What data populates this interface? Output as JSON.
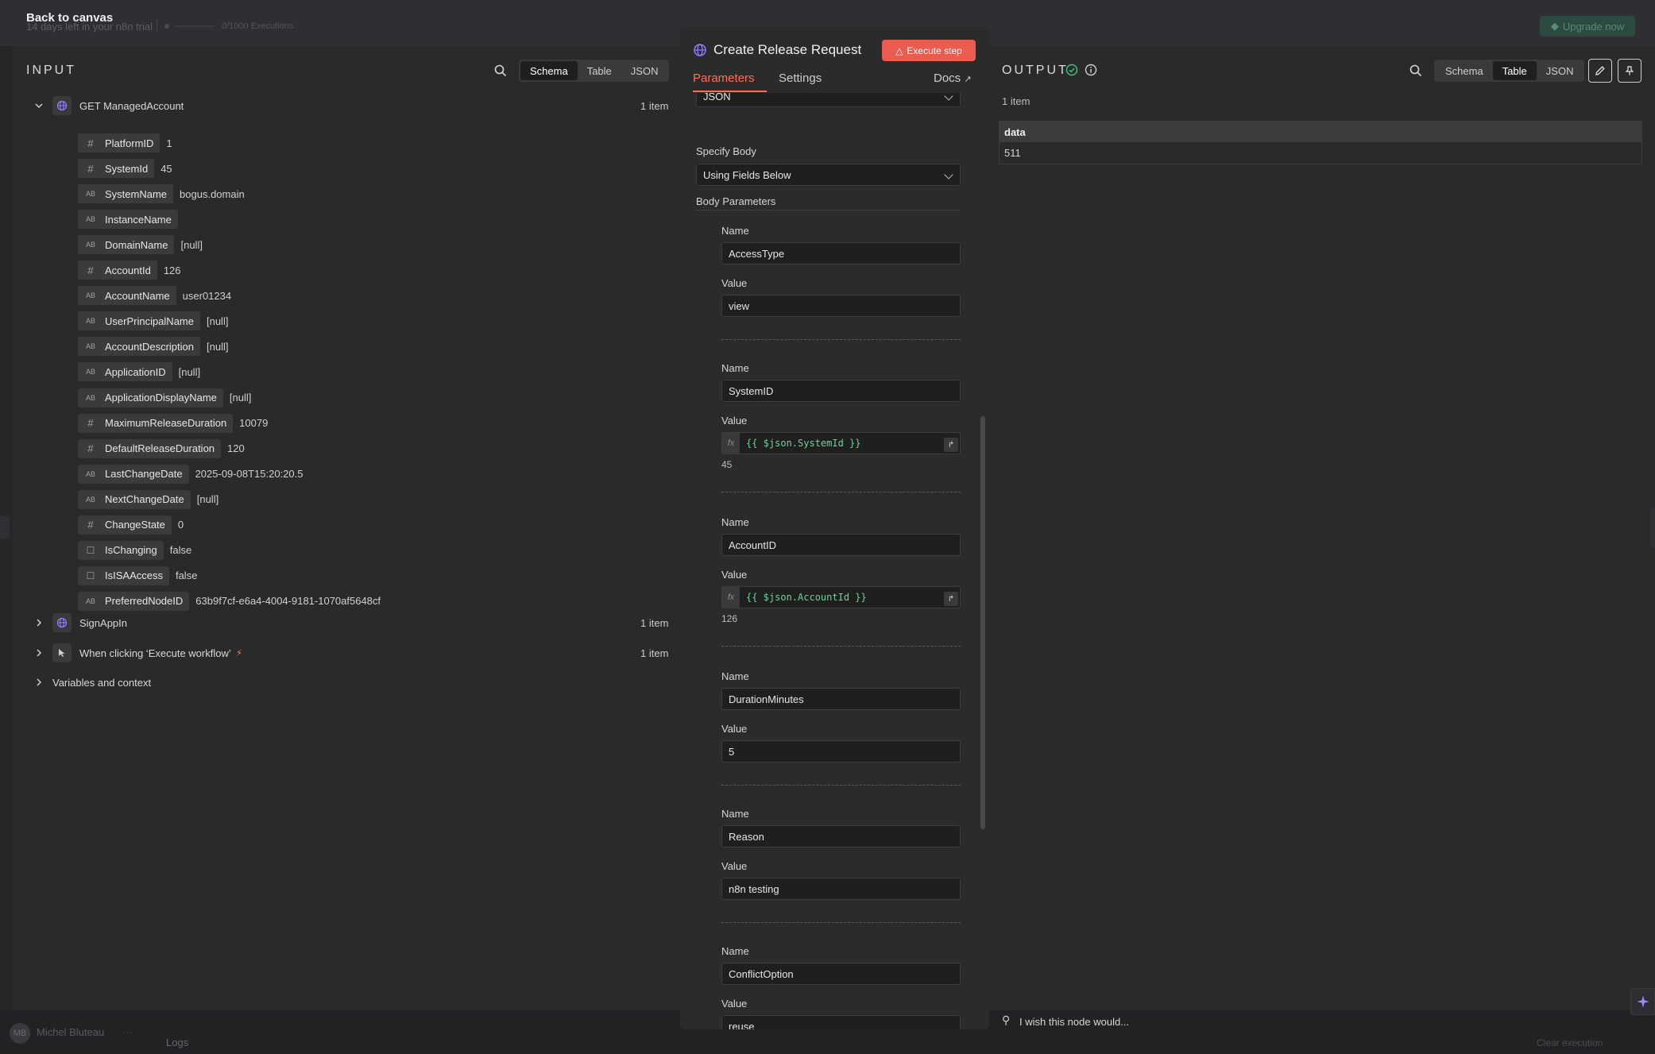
{
  "background": {
    "back_link": "Back to canvas",
    "trial_text": "14 days left in your n8n trial",
    "executions": "0/1000 Executions",
    "upgrade": "Upgrade now",
    "user_initials": "MB",
    "user_name": "Michel Bluteau",
    "logs": "Logs",
    "clear_execution": "Clear execution"
  },
  "input": {
    "title": "INPUT",
    "view_tabs": [
      "Schema",
      "Table",
      "JSON"
    ],
    "active_view": "Schema",
    "node": {
      "name": "GET ManagedAccount",
      "count": "1 item",
      "icon": "globe-icon"
    },
    "fields": [
      {
        "type": "#",
        "name": "PlatformID",
        "value": "1"
      },
      {
        "type": "AB",
        "name": "SystemId",
        "value": "45",
        "num": true
      },
      {
        "type": "AB",
        "name": "SystemName",
        "value": "bogus.domain"
      },
      {
        "type": "AB",
        "name": "InstanceName",
        "value": ""
      },
      {
        "type": "AB",
        "name": "DomainName",
        "value": "[null]"
      },
      {
        "type": "#",
        "name": "AccountId",
        "value": "126"
      },
      {
        "type": "AB",
        "name": "AccountName",
        "value": "user01234"
      },
      {
        "type": "AB",
        "name": "UserPrincipalName",
        "value": "[null]"
      },
      {
        "type": "AB",
        "name": "AccountDescription",
        "value": "[null]"
      },
      {
        "type": "AB",
        "name": "ApplicationID",
        "value": "[null]"
      },
      {
        "type": "AB",
        "name": "ApplicationDisplayName",
        "value": "[null]"
      },
      {
        "type": "#",
        "name": "MaximumReleaseDuration",
        "value": "10079"
      },
      {
        "type": "#",
        "name": "DefaultReleaseDuration",
        "value": "120"
      },
      {
        "type": "AB",
        "name": "LastChangeDate",
        "value": "2025-09-08T15:20:20.5"
      },
      {
        "type": "AB",
        "name": "NextChangeDate",
        "value": "[null]"
      },
      {
        "type": "#",
        "name": "ChangeState",
        "value": "0"
      },
      {
        "type": "bool",
        "name": "IsChanging",
        "value": "false"
      },
      {
        "type": "bool",
        "name": "IsISAAccess",
        "value": "false"
      },
      {
        "type": "AB",
        "name": "PreferredNodeID",
        "value": "63b9f7cf-e6a4-4004-9181-1070af5648cf"
      }
    ],
    "other_nodes": [
      {
        "name": "SignAppIn",
        "count": "1 item",
        "icon": "globe-icon"
      },
      {
        "name": "When clicking ‘Execute workflow’",
        "count": "1 item",
        "icon": "cursor-icon"
      }
    ],
    "variables": "Variables and context"
  },
  "center": {
    "title": "Create Release Request",
    "execute_step": "Execute step",
    "tabs": [
      "Parameters",
      "Settings"
    ],
    "docs": "Docs",
    "top_select_value": "JSON",
    "specify_body_label": "Specify Body",
    "specify_body_value": "Using Fields Below",
    "body_params_label": "Body Parameters",
    "name_label": "Name",
    "value_label": "Value",
    "params": [
      {
        "name": "AccessType",
        "value": "view"
      },
      {
        "name": "SystemID",
        "expression": "{{ $json.SystemId }}",
        "result": "45"
      },
      {
        "name": "AccountID",
        "expression": "{{ $json.AccountId }}",
        "result": "126"
      },
      {
        "name": "DurationMinutes",
        "value": "5"
      },
      {
        "name": "Reason",
        "value": "n8n testing"
      },
      {
        "name": "ConflictOption",
        "value": "reuse"
      }
    ]
  },
  "output": {
    "title": "OUTPUT",
    "view_tabs": [
      "Schema",
      "Table",
      "JSON"
    ],
    "active_view": "Table",
    "item_count": "1 item",
    "table_header": "data",
    "table_value": "511",
    "wish": "I wish this node would..."
  }
}
